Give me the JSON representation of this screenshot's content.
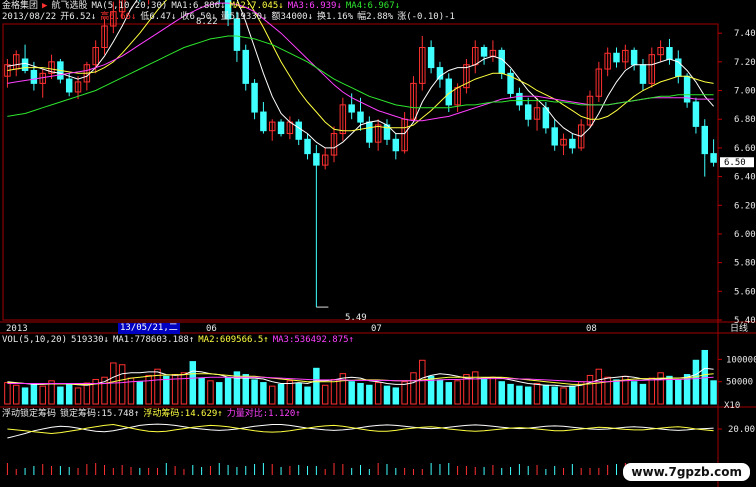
{
  "header": {
    "logo_label": "金格集团",
    "stock_name": "航飞选股",
    "ma_params": "MA(5,10,20,30)",
    "ma1": "MA1:6.886↓",
    "ma2": "MA2:7.045↓",
    "ma3": "MA3:6.939↓",
    "ma4": "MA4:6.967↓",
    "date": "2013/08/22",
    "open": "开6.52↓",
    "high": "高6.66↓",
    "low": "低6.47↓",
    "close": "收6.50↓",
    "volume": "量519330↓",
    "amount": "额34000↓",
    "turnover": "换1.16%",
    "amplitude": "幅2.88%",
    "change": "涨(-0.10)-1"
  },
  "price_axis": {
    "ticks": [
      "7.40",
      "7.20",
      "7.00",
      "6.80",
      "6.60",
      "6.40",
      "6.20",
      "6.00",
      "5.80",
      "5.60",
      "5.40"
    ],
    "current_price": "6.50",
    "high_annotation": "8.22",
    "low_annotation": "5.49"
  },
  "time_axis": {
    "labels": [
      "2013",
      "06",
      "07",
      "08"
    ],
    "cursor_date": "13/05/21,二",
    "period": "日线"
  },
  "volume_panel": {
    "title": "VOL(5,10,20)",
    "current": "519330↓",
    "ma1": "MA1:778603.188↑",
    "ma2": "MA2:609566.5↑",
    "ma3": "MA3:536492.875↑",
    "ticks": [
      "100000",
      "50000"
    ],
    "unit": "X10"
  },
  "indicator_panel": {
    "name": "浮动锁定筹码",
    "line1": "锁定筹码:15.748↑",
    "line2": "浮动筹码:14.629↑",
    "line3": "力量对比:1.120↑",
    "tick": "20.00"
  },
  "watermark": "www.7gpzb.com",
  "colors": {
    "up": "#ff3030",
    "down": "#40ffff",
    "ma1": "#ffffff",
    "ma2": "#ffff40",
    "ma3": "#ff40ff",
    "ma4": "#2ee62e"
  },
  "chart_data": {
    "type": "candlestick",
    "ylim": [
      5.4,
      7.45
    ],
    "candles": [
      [
        7.1,
        7.22,
        7.02,
        7.18
      ],
      [
        7.15,
        7.28,
        7.1,
        7.25
      ],
      [
        7.22,
        7.32,
        7.12,
        7.14
      ],
      [
        7.14,
        7.2,
        7.0,
        7.05
      ],
      [
        7.05,
        7.15,
        6.95,
        7.12
      ],
      [
        7.12,
        7.25,
        7.08,
        7.2
      ],
      [
        7.2,
        7.22,
        7.05,
        7.08
      ],
      [
        7.08,
        7.12,
        6.96,
        6.99
      ],
      [
        6.99,
        7.1,
        6.94,
        7.06
      ],
      [
        7.06,
        7.2,
        7.0,
        7.18
      ],
      [
        7.18,
        7.35,
        7.12,
        7.3
      ],
      [
        7.3,
        7.5,
        7.25,
        7.45
      ],
      [
        7.45,
        7.62,
        7.4,
        7.55
      ],
      [
        7.55,
        7.8,
        7.5,
        7.7
      ],
      [
        7.7,
        7.9,
        7.65,
        7.85
      ],
      [
        7.85,
        7.88,
        7.62,
        7.66
      ],
      [
        7.66,
        7.95,
        7.6,
        7.9
      ],
      [
        7.9,
        8.05,
        7.85,
        7.98
      ],
      [
        7.98,
        8.02,
        7.8,
        7.84
      ],
      [
        7.84,
        7.98,
        7.78,
        7.95
      ],
      [
        7.95,
        8.1,
        7.9,
        8.05
      ],
      [
        8.05,
        8.22,
        7.95,
        7.98
      ],
      [
        7.98,
        8.0,
        7.75,
        7.8
      ],
      [
        7.8,
        7.95,
        7.72,
        7.9
      ],
      [
        7.9,
        7.92,
        7.6,
        7.65
      ],
      [
        7.65,
        7.7,
        7.45,
        7.5
      ],
      [
        7.5,
        7.55,
        7.2,
        7.28
      ],
      [
        7.28,
        7.32,
        7.0,
        7.05
      ],
      [
        7.05,
        7.08,
        6.8,
        6.85
      ],
      [
        6.85,
        6.92,
        6.7,
        6.72
      ],
      [
        6.72,
        6.8,
        6.65,
        6.78
      ],
      [
        6.78,
        6.8,
        6.68,
        6.7
      ],
      [
        6.7,
        6.82,
        6.66,
        6.78
      ],
      [
        6.78,
        6.8,
        6.62,
        6.66
      ],
      [
        6.66,
        6.7,
        6.52,
        6.56
      ],
      [
        6.56,
        6.62,
        5.49,
        6.48
      ],
      [
        6.48,
        6.6,
        6.45,
        6.55
      ],
      [
        6.55,
        6.75,
        6.5,
        6.7
      ],
      [
        6.7,
        6.95,
        6.65,
        6.9
      ],
      [
        6.9,
        6.98,
        6.8,
        6.85
      ],
      [
        6.85,
        6.95,
        6.72,
        6.78
      ],
      [
        6.78,
        6.82,
        6.6,
        6.64
      ],
      [
        6.64,
        6.8,
        6.58,
        6.76
      ],
      [
        6.76,
        6.8,
        6.62,
        6.66
      ],
      [
        6.66,
        6.7,
        6.52,
        6.58
      ],
      [
        6.58,
        6.85,
        6.56,
        6.8
      ],
      [
        6.8,
        7.1,
        6.78,
        7.05
      ],
      [
        7.05,
        7.38,
        7.0,
        7.3
      ],
      [
        7.3,
        7.35,
        7.12,
        7.16
      ],
      [
        7.16,
        7.2,
        7.02,
        7.08
      ],
      [
        7.08,
        7.12,
        6.85,
        6.9
      ],
      [
        6.9,
        7.05,
        6.85,
        7.02
      ],
      [
        7.02,
        7.22,
        6.98,
        7.18
      ],
      [
        7.18,
        7.35,
        7.12,
        7.3
      ],
      [
        7.3,
        7.32,
        7.18,
        7.24
      ],
      [
        7.24,
        7.35,
        7.2,
        7.28
      ],
      [
        7.28,
        7.3,
        7.08,
        7.12
      ],
      [
        7.12,
        7.15,
        6.95,
        6.98
      ],
      [
        6.98,
        7.02,
        6.86,
        6.9
      ],
      [
        6.9,
        6.95,
        6.75,
        6.8
      ],
      [
        6.8,
        6.95,
        6.72,
        6.88
      ],
      [
        6.88,
        6.92,
        6.7,
        6.74
      ],
      [
        6.74,
        6.8,
        6.58,
        6.62
      ],
      [
        6.62,
        6.7,
        6.55,
        6.66
      ],
      [
        6.66,
        6.7,
        6.56,
        6.6
      ],
      [
        6.6,
        6.8,
        6.58,
        6.76
      ],
      [
        6.76,
        7.0,
        6.74,
        6.96
      ],
      [
        6.96,
        7.2,
        6.92,
        7.15
      ],
      [
        7.15,
        7.3,
        7.1,
        7.26
      ],
      [
        7.26,
        7.3,
        7.16,
        7.2
      ],
      [
        7.2,
        7.32,
        7.15,
        7.28
      ],
      [
        7.28,
        7.3,
        7.14,
        7.18
      ],
      [
        7.18,
        7.22,
        7.0,
        7.05
      ],
      [
        7.05,
        7.3,
        7.02,
        7.25
      ],
      [
        7.25,
        7.35,
        7.2,
        7.3
      ],
      [
        7.3,
        7.36,
        7.18,
        7.22
      ],
      [
        7.22,
        7.28,
        7.05,
        7.1
      ],
      [
        7.1,
        7.12,
        6.88,
        6.92
      ],
      [
        6.92,
        6.95,
        6.7,
        6.75
      ],
      [
        6.75,
        6.8,
        6.4,
        6.56
      ],
      [
        6.56,
        6.66,
        6.47,
        6.5
      ]
    ],
    "ma_series": [
      {
        "name": "MA1",
        "values": [
          7.17,
          7.18,
          7.19,
          7.17,
          7.15,
          7.13,
          7.12,
          7.1,
          7.08,
          7.1,
          7.16,
          7.24,
          7.34,
          7.45,
          7.57,
          7.66,
          7.74,
          7.82,
          7.86,
          7.88,
          7.92,
          7.94,
          7.92,
          7.9,
          7.86,
          7.78,
          7.64,
          7.48,
          7.3,
          7.12,
          6.96,
          6.84,
          6.78,
          6.74,
          6.7,
          6.64,
          6.6,
          6.6,
          6.64,
          6.7,
          6.76,
          6.78,
          6.79,
          6.76,
          6.7,
          6.7,
          6.78,
          6.92,
          7.02,
          7.1,
          7.14,
          7.16,
          7.16,
          7.18,
          7.22,
          7.24,
          7.22,
          7.16,
          7.08,
          7.0,
          6.94,
          6.88,
          6.8,
          6.74,
          6.7,
          6.68,
          6.74,
          6.84,
          6.96,
          7.06,
          7.14,
          7.18,
          7.18,
          7.18,
          7.2,
          7.22,
          7.2,
          7.14,
          7.06,
          6.96,
          6.89
        ]
      },
      {
        "name": "MA2",
        "values": [
          7.14,
          7.15,
          7.16,
          7.16,
          7.16,
          7.15,
          7.14,
          7.13,
          7.12,
          7.12,
          7.13,
          7.16,
          7.2,
          7.26,
          7.33,
          7.4,
          7.48,
          7.56,
          7.63,
          7.7,
          7.76,
          7.8,
          7.84,
          7.85,
          7.84,
          7.8,
          7.74,
          7.65,
          7.55,
          7.44,
          7.32,
          7.2,
          7.1,
          7.0,
          6.92,
          6.85,
          6.78,
          6.73,
          6.72,
          6.72,
          6.73,
          6.74,
          6.75,
          6.74,
          6.74,
          6.74,
          6.76,
          6.81,
          6.86,
          6.92,
          6.98,
          7.02,
          7.05,
          7.08,
          7.1,
          7.12,
          7.12,
          7.1,
          7.07,
          7.04,
          7.0,
          6.97,
          6.94,
          6.9,
          6.86,
          6.82,
          6.8,
          6.8,
          6.82,
          6.86,
          6.91,
          6.96,
          7.0,
          7.03,
          7.06,
          7.08,
          7.1,
          7.1,
          7.08,
          7.06,
          7.05
        ]
      },
      {
        "name": "MA3",
        "values": [
          7.05,
          7.06,
          7.07,
          7.08,
          7.09,
          7.1,
          7.11,
          7.12,
          7.13,
          7.14,
          7.16,
          7.18,
          7.21,
          7.24,
          7.28,
          7.32,
          7.36,
          7.4,
          7.44,
          7.48,
          7.52,
          7.55,
          7.58,
          7.6,
          7.61,
          7.61,
          7.6,
          7.58,
          7.55,
          7.5,
          7.45,
          7.4,
          7.34,
          7.28,
          7.22,
          7.16,
          7.1,
          7.04,
          6.99,
          6.95,
          6.92,
          6.89,
          6.86,
          6.84,
          6.82,
          6.8,
          6.79,
          6.79,
          6.8,
          6.81,
          6.82,
          6.84,
          6.86,
          6.88,
          6.9,
          6.92,
          6.94,
          6.95,
          6.96,
          6.96,
          6.96,
          6.95,
          6.94,
          6.93,
          6.92,
          6.91,
          6.9,
          6.9,
          6.9,
          6.91,
          6.92,
          6.93,
          6.94,
          6.95,
          6.95,
          6.95,
          6.95,
          6.95,
          6.94,
          6.94,
          6.94
        ]
      },
      {
        "name": "MA4",
        "values": [
          6.82,
          6.83,
          6.84,
          6.86,
          6.88,
          6.9,
          6.92,
          6.94,
          6.96,
          6.98,
          7.0,
          7.03,
          7.06,
          7.09,
          7.12,
          7.15,
          7.18,
          7.21,
          7.24,
          7.27,
          7.3,
          7.32,
          7.34,
          7.36,
          7.37,
          7.38,
          7.38,
          7.37,
          7.36,
          7.34,
          7.32,
          7.29,
          7.26,
          7.23,
          7.2,
          7.16,
          7.12,
          7.08,
          7.05,
          7.02,
          6.99,
          6.96,
          6.94,
          6.92,
          6.9,
          6.89,
          6.88,
          6.88,
          6.88,
          6.88,
          6.88,
          6.89,
          6.9,
          6.9,
          6.91,
          6.92,
          6.92,
          6.93,
          6.93,
          6.93,
          6.93,
          6.93,
          6.92,
          6.92,
          6.91,
          6.9,
          6.9,
          6.9,
          6.9,
          6.91,
          6.92,
          6.93,
          6.94,
          6.95,
          6.96,
          6.96,
          6.97,
          6.97,
          6.97,
          6.97,
          6.97
        ]
      }
    ],
    "volume": [
      48,
      42,
      36,
      45,
      40,
      52,
      38,
      44,
      36,
      47,
      55,
      60,
      92,
      88,
      58,
      50,
      64,
      78,
      62,
      66,
      70,
      95,
      58,
      52,
      48,
      60,
      72,
      66,
      54,
      48,
      40,
      44,
      52,
      46,
      38,
      80,
      42,
      55,
      68,
      50,
      46,
      42,
      48,
      40,
      36,
      50,
      70,
      98,
      62,
      54,
      48,
      52,
      66,
      72,
      58,
      60,
      50,
      44,
      40,
      38,
      46,
      42,
      38,
      36,
      40,
      50,
      64,
      78,
      60,
      54,
      62,
      50,
      44,
      58,
      70,
      62,
      54,
      66,
      98,
      120,
      52
    ],
    "volume_ma": [
      {
        "name": "MA1",
        "values": [
          50,
          48,
          46,
          44,
          44,
          45,
          45,
          45,
          43,
          42,
          45,
          50,
          60,
          68,
          70,
          70,
          72,
          72,
          66,
          64,
          66,
          74,
          72,
          68,
          66,
          60,
          58,
          58,
          58,
          56,
          50,
          46,
          46,
          48,
          46,
          52,
          52,
          54,
          58,
          60,
          58,
          52,
          50,
          46,
          44,
          44,
          48,
          58,
          64,
          68,
          66,
          62,
          58,
          56,
          58,
          60,
          58,
          54,
          50,
          46,
          44,
          42,
          42,
          40,
          40,
          42,
          48,
          54,
          58,
          60,
          62,
          60,
          56,
          54,
          56,
          58,
          58,
          60,
          66,
          80,
          78
        ]
      },
      {
        "name": "MA2",
        "values": [
          48,
          47,
          46,
          46,
          45,
          45,
          45,
          45,
          44,
          44,
          45,
          46,
          50,
          54,
          58,
          60,
          62,
          64,
          65,
          66,
          66,
          68,
          68,
          68,
          66,
          64,
          62,
          62,
          62,
          60,
          58,
          56,
          54,
          52,
          50,
          50,
          50,
          50,
          52,
          53,
          54,
          54,
          54,
          53,
          52,
          52,
          52,
          54,
          56,
          58,
          60,
          60,
          60,
          60,
          60,
          60,
          60,
          58,
          56,
          54,
          52,
          50,
          48,
          46,
          44,
          44,
          45,
          47,
          50,
          52,
          54,
          56,
          57,
          57,
          58,
          58,
          58,
          59,
          61,
          66,
          68
        ]
      },
      {
        "name": "MA3",
        "values": [
          46,
          46,
          46,
          46,
          46,
          46,
          46,
          46,
          46,
          46,
          46,
          46,
          47,
          48,
          50,
          51,
          52,
          54,
          55,
          56,
          57,
          58,
          59,
          60,
          60,
          60,
          60,
          60,
          60,
          60,
          59,
          58,
          57,
          56,
          55,
          54,
          54,
          54,
          54,
          53,
          53,
          53,
          53,
          53,
          52,
          52,
          52,
          52,
          53,
          54,
          55,
          55,
          56,
          56,
          57,
          57,
          57,
          57,
          56,
          56,
          55,
          54,
          53,
          52,
          51,
          50,
          50,
          50,
          50,
          51,
          52,
          53,
          53,
          54,
          54,
          55,
          55,
          56,
          57,
          59,
          60
        ]
      }
    ],
    "indicator": [
      {
        "name": "锁定筹码",
        "values": [
          18,
          18.5,
          19,
          19.6,
          20,
          20.4,
          20.6,
          20.5,
          20.2,
          19.8,
          19.5,
          19.4,
          19.6,
          20,
          20.4,
          20.8,
          21,
          21.1,
          21,
          20.8,
          20.5,
          20.2,
          20,
          19.8,
          19.7,
          19.8,
          20,
          20.3,
          20.6,
          20.8,
          21,
          21,
          20.8,
          20.5,
          20.2,
          20,
          19.8,
          19.7,
          19.8,
          20,
          20.3,
          20.6,
          20.8,
          20.9,
          20.8,
          20.6,
          20.4,
          20.2,
          20.1,
          20.2,
          20.4,
          20.6,
          20.8,
          20.9,
          20.8,
          20.6,
          20.4,
          20.2,
          20.1,
          20.2,
          20.4,
          20.6,
          20.7,
          20.6,
          20.4,
          20.2,
          20,
          19.9,
          20,
          20.2,
          20.4,
          20.5,
          20.4,
          20.2,
          20,
          19.8,
          19.7,
          19.8,
          20,
          20.1,
          20.2
        ]
      },
      {
        "name": "浮动筹码",
        "values": [
          20,
          19.8,
          19.6,
          19.4,
          19.2,
          19,
          19.2,
          19.5,
          19.8,
          20.2,
          20.5,
          20.8,
          21,
          20.6,
          20.2,
          19.8,
          19.5,
          19.4,
          19.5,
          19.8,
          20.1,
          20.4,
          20.6,
          20.8,
          20.7,
          20.5,
          20.2,
          19.9,
          19.6,
          19.4,
          19.3,
          19.4,
          19.6,
          19.9,
          20.2,
          20.5,
          20.7,
          20.8,
          20.6,
          20.3,
          20,
          19.7,
          19.5,
          19.5,
          19.7,
          20,
          20.2,
          20.4,
          20.5,
          20.3,
          20,
          19.8,
          19.6,
          19.5,
          19.6,
          19.8,
          20,
          20.2,
          20.3,
          20.2,
          20,
          19.8,
          19.6,
          19.6,
          19.8,
          20,
          20.2,
          20.4,
          20.3,
          20.1,
          19.9,
          19.8,
          19.8,
          20,
          20.2,
          20.4,
          20.5,
          20.3,
          20,
          19.8,
          19.6
        ]
      }
    ]
  }
}
